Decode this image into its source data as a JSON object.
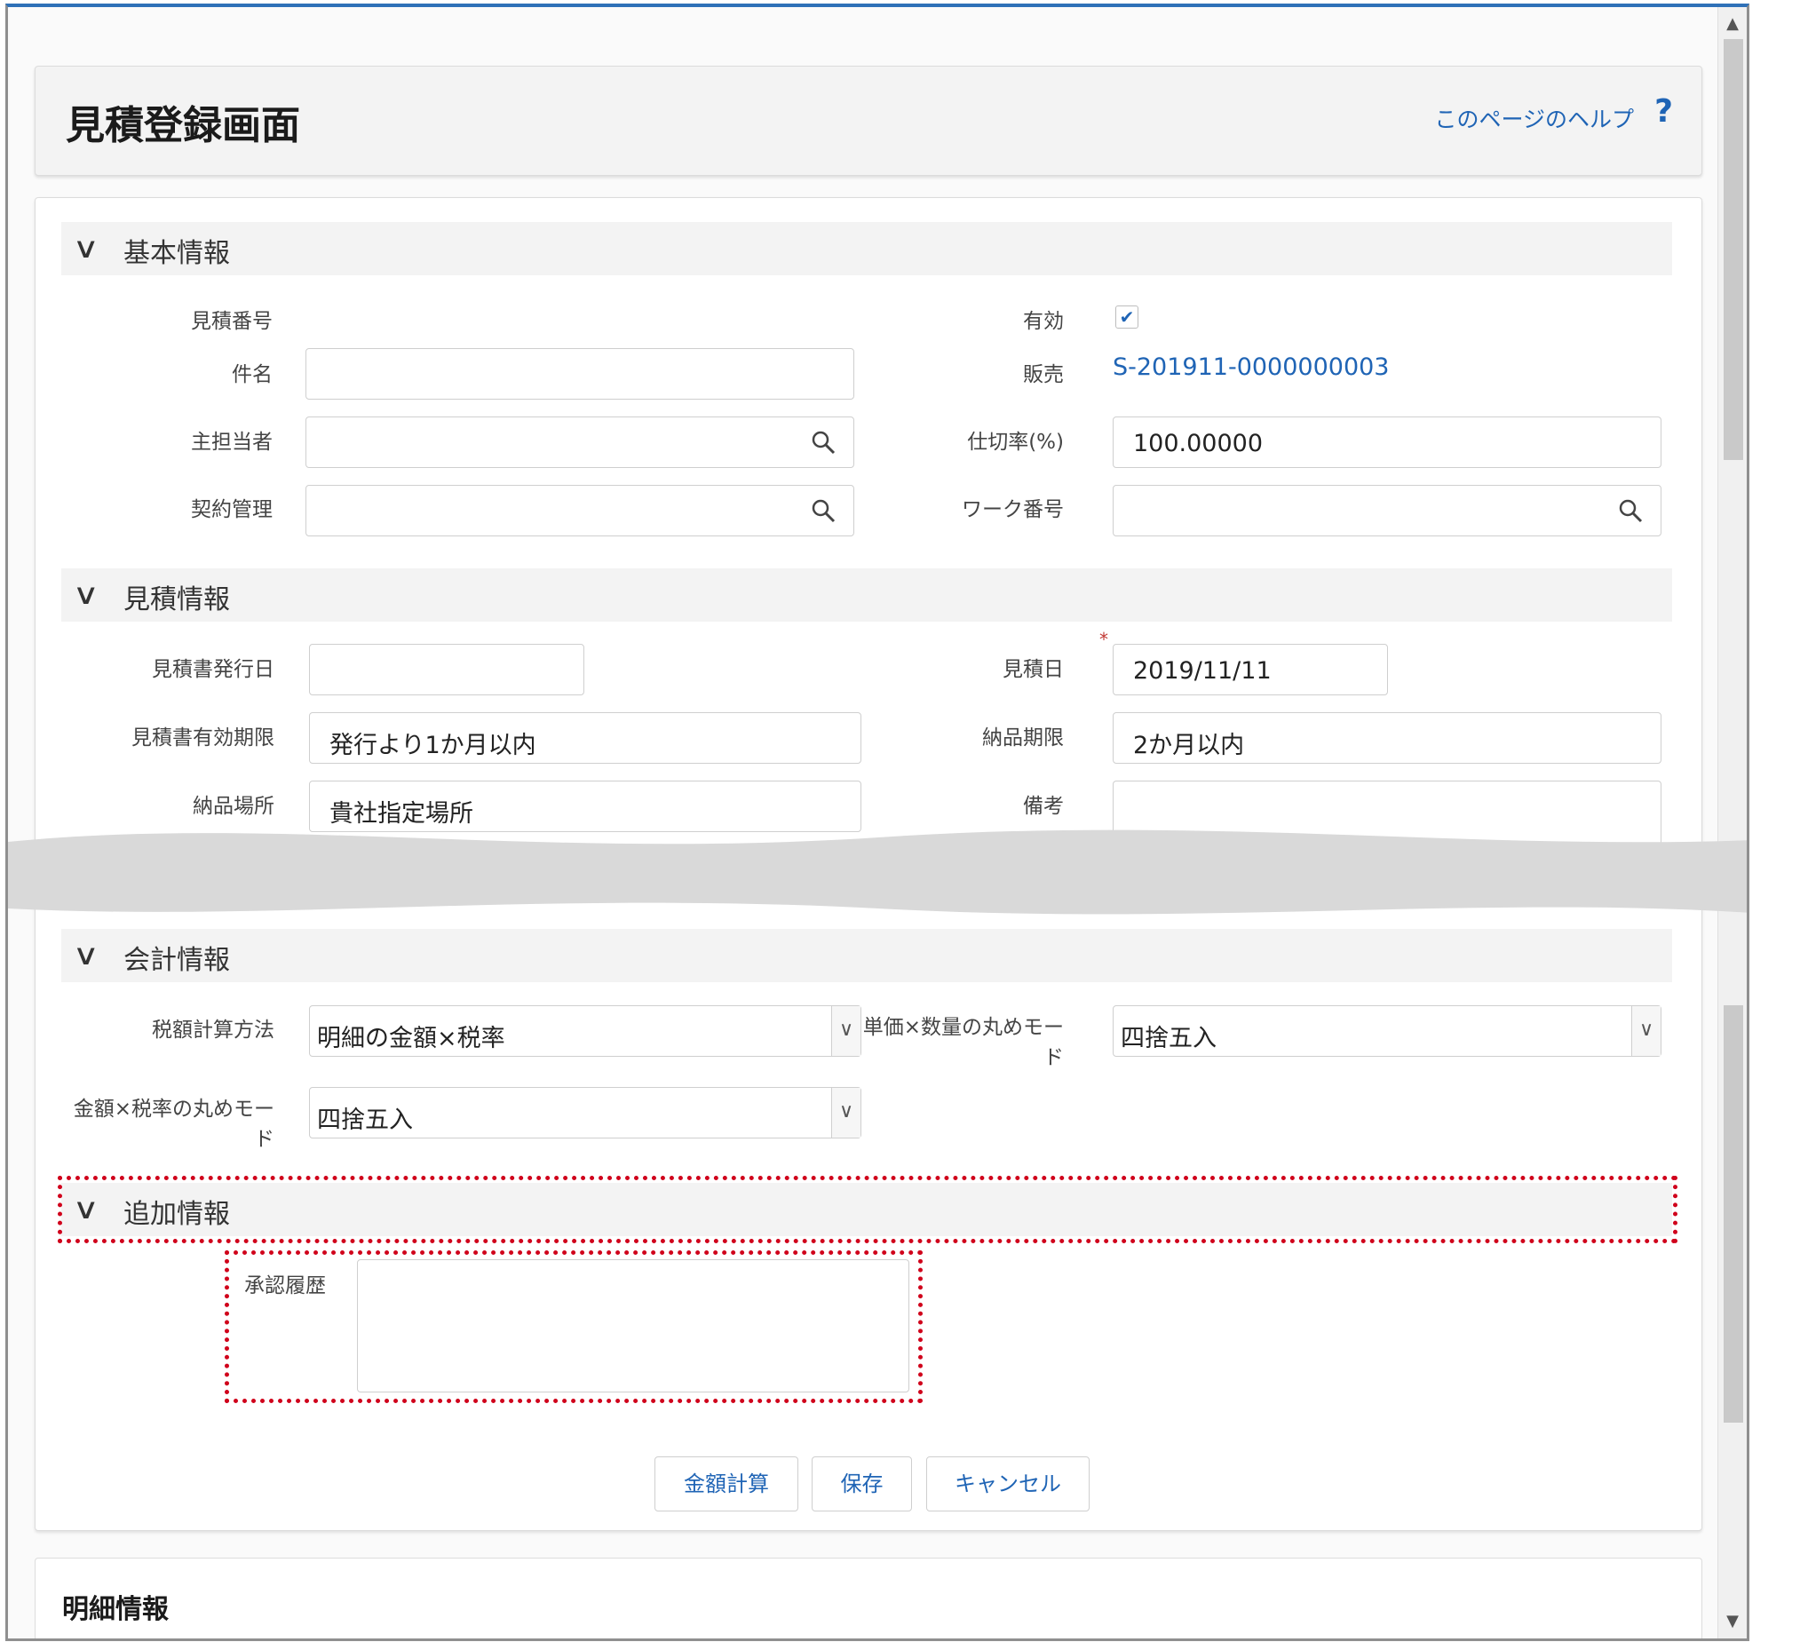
{
  "header": {
    "title": "見積登録画面",
    "help_label": "このページのヘルプ",
    "help_icon_glyph": "?"
  },
  "sections": {
    "basic": {
      "title": "基本情報",
      "fields": {
        "estimate_number_label": "見積番号",
        "valid_label": "有効",
        "valid_checked": true,
        "subject_label": "件名",
        "subject_value": "",
        "sales_label": "販売",
        "sales_value": "S-201911-0000000003",
        "owner_label": "主担当者",
        "owner_value": "",
        "rate_label": "仕切率(%)",
        "rate_value": "100.00000",
        "contract_label": "契約管理",
        "contract_value": "",
        "work_no_label": "ワーク番号",
        "work_no_value": ""
      }
    },
    "estimate": {
      "title": "見積情報",
      "fields": {
        "issue_date_label": "見積書発行日",
        "issue_date_value": "",
        "estimate_date_label": "見積日",
        "estimate_date_value": "2019/11/11",
        "required_mark": "*",
        "validity_label": "見積書有効期限",
        "validity_value": "発行より1か月以内",
        "delivery_deadline_label": "納品期限",
        "delivery_deadline_value": "2か月以内",
        "delivery_place_label": "納品場所",
        "delivery_place_value": "貴社指定場所",
        "remarks_label": "備考",
        "remarks_value": ""
      }
    },
    "accounting": {
      "title": "会計情報",
      "fields": {
        "tax_method_label": "税額計算方法",
        "tax_method_value": "明細の金額×税率",
        "unit_round_label_1": "単価×数量の丸めモー",
        "unit_round_label_2": "ド",
        "unit_round_value": "四捨五入",
        "amount_round_label_1": "金額×税率の丸めモー",
        "amount_round_label_2": "ド",
        "amount_round_value": "四捨五入"
      }
    },
    "additional": {
      "title": "追加情報",
      "fields": {
        "approval_history_label": "承認履歴",
        "approval_history_value": ""
      }
    }
  },
  "buttons": {
    "calc": "金額計算",
    "save": "保存",
    "cancel": "キャンセル"
  },
  "detail": {
    "title": "明細情報"
  },
  "icons": {
    "chevron": "chevron-down-icon",
    "search": "search-icon",
    "check": "check-icon"
  },
  "colors": {
    "link": "#1f64b5",
    "highlight": "#d0021b",
    "header_bar": "#2f71b8"
  }
}
